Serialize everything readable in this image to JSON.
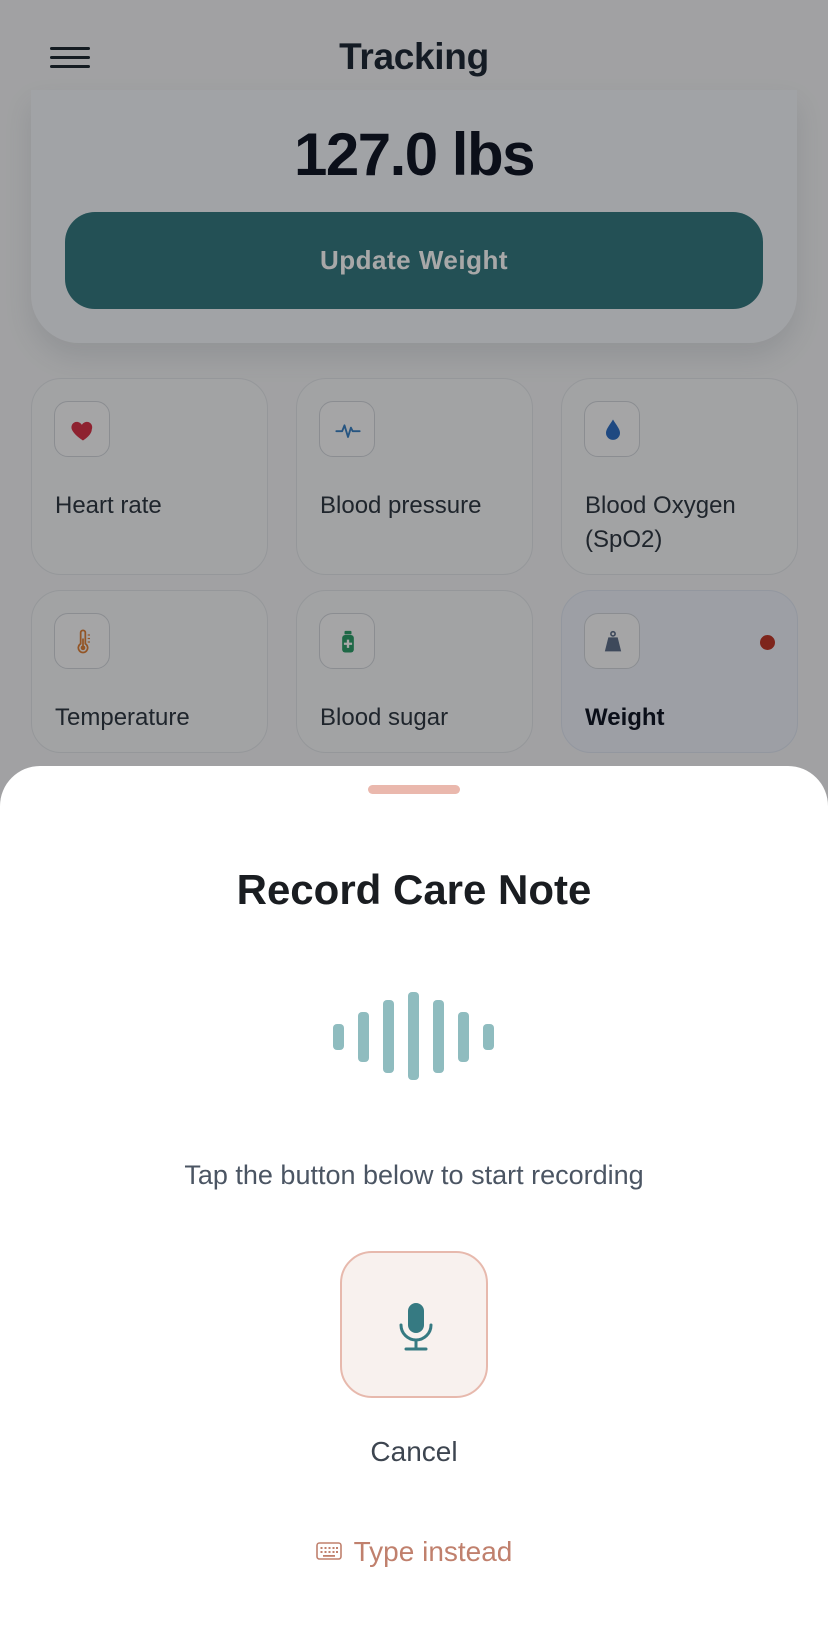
{
  "header": {
    "title": "Tracking"
  },
  "weight_card": {
    "value": "127.0 lbs",
    "update_button": "Update Weight"
  },
  "tiles": [
    {
      "label": "Heart rate",
      "icon": "heart-icon",
      "color": "#d8344a"
    },
    {
      "label": "Blood pressure",
      "icon": "pulse-icon",
      "color": "#3b82c4"
    },
    {
      "label": "Blood Oxygen (SpO2)",
      "icon": "drop-icon",
      "color": "#2f6fc4"
    },
    {
      "label": "Temperature",
      "icon": "thermometer-icon",
      "color": "#e0823a"
    },
    {
      "label": "Blood sugar",
      "icon": "medicine-bottle-icon",
      "color": "#2e9e6b"
    },
    {
      "label": "Weight",
      "icon": "weight-scale-icon",
      "color": "#5f6f8a",
      "selected": true
    }
  ],
  "sheet": {
    "title": "Record Care Note",
    "hint": "Tap the button below to start recording",
    "cancel": "Cancel",
    "type_instead": "Type instead"
  },
  "colors": {
    "accent_teal": "#367a82",
    "sheet_accent": "#c0806d"
  }
}
